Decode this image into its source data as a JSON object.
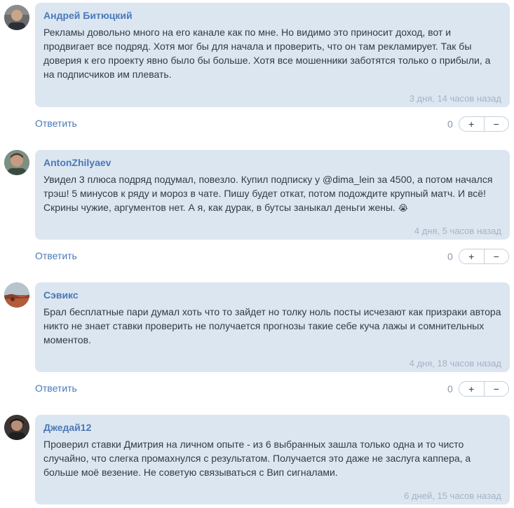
{
  "ui": {
    "reply_label": "Ответить",
    "plus_label": "+",
    "minus_label": "−"
  },
  "comments": [
    {
      "author": "Андрей Битюцкий",
      "text": "Рекламы довольно много на его канале как по мне. Но видимо это приносит доход, вот и продвигает все подряд. Хотя мог бы для начала и проверить, что он там рекламирует. Так бы доверия к его проекту явно было бы больше. Хотя все мошенники заботятся только о прибыли, а на подписчиков им плевать.",
      "time": "3 дня, 14 часов назад",
      "score": "0"
    },
    {
      "author": "AntonZhilyaev",
      "text": "Увидел 3 плюса подряд подумал, повезло. Купил подписку у @dima_lein за 4500, а потом начался трэш! 5 минусов к ряду и мороз в чате. Пишу будет откат, потом подождите крупный матч. И всё! Скрины чужие, аргументов нет. А я, как дурак, в бутсы заныкал деньги жены.",
      "emoji": "😭",
      "time": "4 дня, 5 часов назад",
      "score": "0"
    },
    {
      "author": "Сэвикс",
      "text": "Брал бесплатные пари думал хоть что то зайдет но толку ноль посты исчезают как призраки автора никто не знает ставки проверить не получается прогнозы такие себе куча лажы и сомнительных моментов.",
      "time": "4 дня, 18 часов назад",
      "score": "0"
    },
    {
      "author": "Джедай12",
      "text": "Проверил ставки Дмитрия на личном опыте - из 6 выбранных зашла только одна и то чисто случайно, что слегка промахнулся с результатом. Получается это даже не заслуга каппера, а больше моё везение. Не советую связываться с Вип сигналами.",
      "time": "6 дней, 15 часов назад"
    }
  ]
}
